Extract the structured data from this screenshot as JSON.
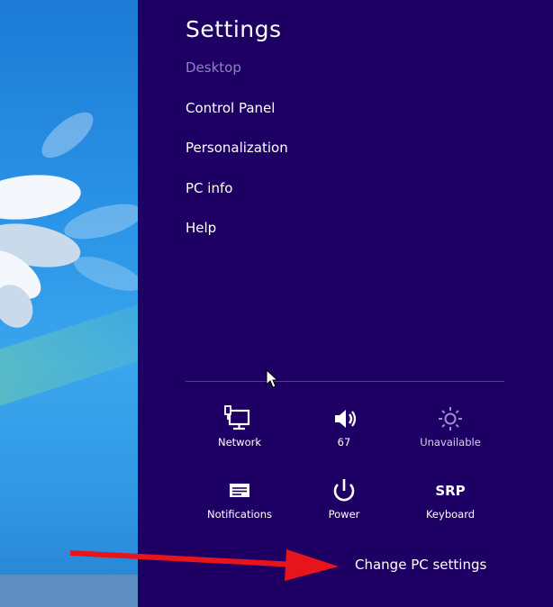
{
  "settings": {
    "title": "Settings",
    "context": "Desktop",
    "items": [
      {
        "label": "Control Panel"
      },
      {
        "label": "Personalization"
      },
      {
        "label": "PC info"
      },
      {
        "label": "Help"
      }
    ]
  },
  "quick_settings": [
    {
      "label": "Network",
      "icon": "network-icon"
    },
    {
      "label": "67",
      "icon": "volume-icon"
    },
    {
      "label": "Unavailable",
      "icon": "brightness-icon"
    },
    {
      "label": "Notifications",
      "icon": "notifications-icon"
    },
    {
      "label": "Power",
      "icon": "power-icon"
    },
    {
      "label": "Keyboard",
      "icon": "keyboard-icon",
      "icon_text": "SRP"
    }
  ],
  "footer": {
    "change_pc_settings": "Change PC settings"
  },
  "colors": {
    "charm_background": "#1e0064",
    "annotation_arrow": "#e8141c"
  }
}
